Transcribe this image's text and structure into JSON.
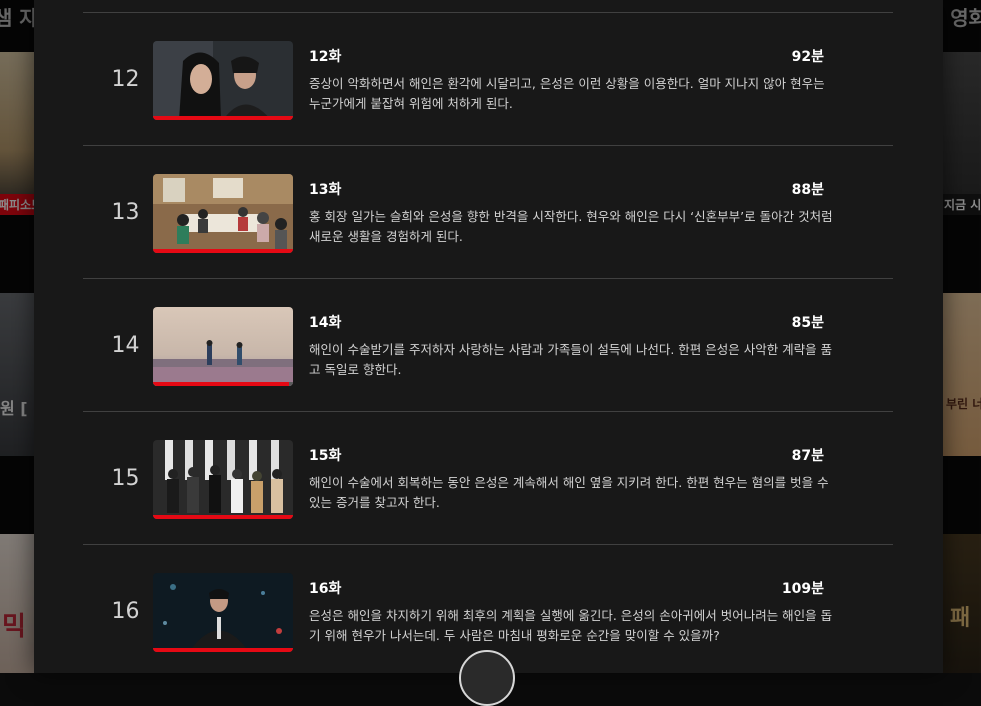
{
  "background": {
    "left_title": "샘 자",
    "right_title": "한 영화",
    "tile_labels": [
      "패피소드",
      "지금 시"
    ],
    "left_tile_text": "원 [",
    "right_tile_text": "부린 너",
    "bottom_left_text": "믹",
    "bottom_right_text": "패"
  },
  "episodes": [
    {
      "index": "12",
      "title": "12화",
      "duration": "92분",
      "progress": 1.0,
      "description": "증상이 악화하면서 해인은 환각에 시달리고, 은성은 이런 상황을 이용한다. 얼마 지나지 않아 현우는 누군가에게 붙잡혀 위험에 처하게 된다."
    },
    {
      "index": "13",
      "title": "13화",
      "duration": "88분",
      "progress": 1.0,
      "description": "홍 회장 일가는 슬희와 은성을 향한 반격을 시작한다. 현우와 해인은 다시 ‘신혼부부’로 돌아간 것처럼 새로운 생활을 경험하게 된다."
    },
    {
      "index": "14",
      "title": "14화",
      "duration": "85분",
      "progress": 0.97,
      "description": "해인이 수술받기를 주저하자 사랑하는 사람과 가족들이 설득에 나선다. 한편 은성은 사악한 계략을 품고 독일로 향한다."
    },
    {
      "index": "15",
      "title": "15화",
      "duration": "87분",
      "progress": 1.0,
      "description": "해인이 수술에서 회복하는 동안 은성은 계속해서 해인 옆을 지키려 한다. 한편 현우는 혐의를 벗을 수 있는 증거를 찾고자 한다."
    },
    {
      "index": "16",
      "title": "16화",
      "duration": "109분",
      "progress": 1.0,
      "description": "은성은 해인을 차지하기 위해 최후의 계획을 실행에 옮긴다. 은성의 손아귀에서 벗어나려는 해인을 돕기 위해 현우가 나서는데. 두 사람은 마침내 평화로운 순간을 맞이할 수 있을까?"
    }
  ],
  "colors": {
    "modal_bg": "#181818",
    "progress": "#e50914",
    "divider": "#404040"
  }
}
